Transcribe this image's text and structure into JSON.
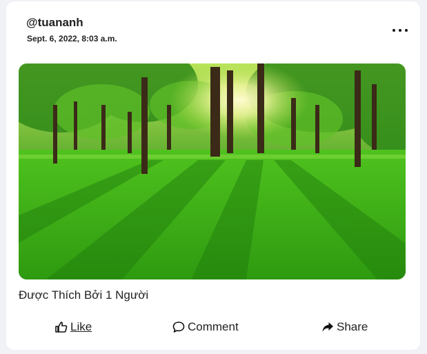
{
  "post": {
    "username": "@tuananh",
    "timestamp": "Sept. 6, 2022, 8:03 a.m.",
    "likes_text": "Được Thích Bởi 1 Người",
    "image_alt": "forest-park-photo"
  },
  "actions": {
    "like_label": "Like",
    "comment_label": "Comment",
    "share_label": "Share"
  },
  "icons": {
    "more": "ellipsis-icon",
    "like": "thumbs-up-icon",
    "comment": "speech-bubble-icon",
    "share": "share-arrow-icon"
  }
}
